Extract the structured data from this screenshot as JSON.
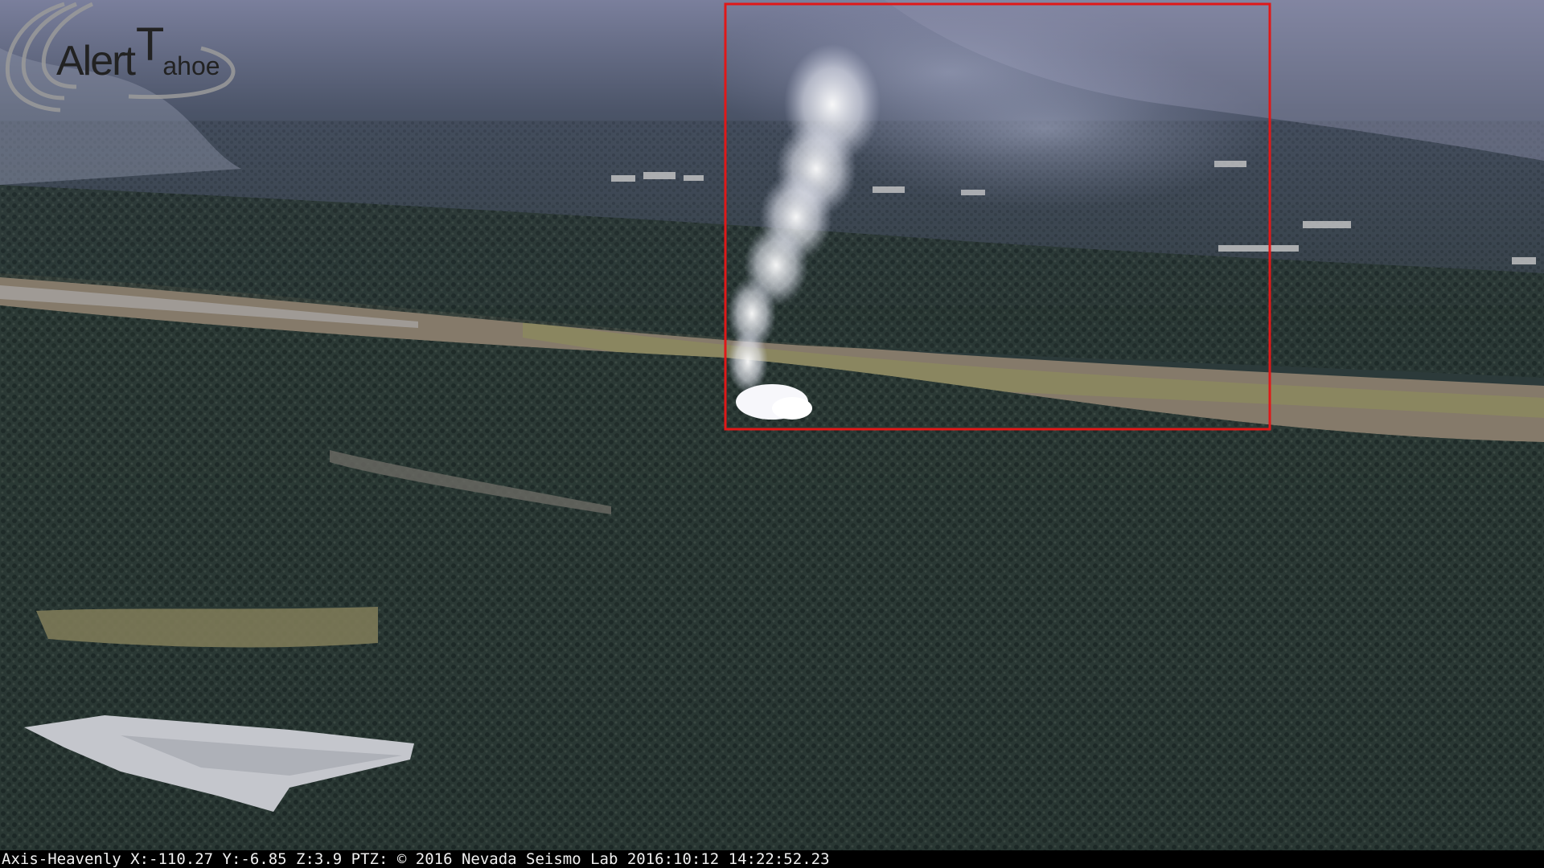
{
  "logo": {
    "text_part1": "Alert",
    "text_part2": "T",
    "text_part3": "ahoe"
  },
  "overlay": {
    "status_line": "Axis-Heavenly X:-110.27 Y:-6.85 Z:3.9 PTZ: © 2016 Nevada Seismo Lab 2016:10:12 14:22:52.23"
  },
  "colors": {
    "forest_dark": "#1f2c2a",
    "forest_mid": "#34423e",
    "meadow": "#8a7d6c",
    "haze": "#6b7392",
    "smoke": "#f1f2f7",
    "detection_box": "#e01818",
    "status_bar_bg": "#000000",
    "status_bar_text": "#f0f0f0"
  }
}
